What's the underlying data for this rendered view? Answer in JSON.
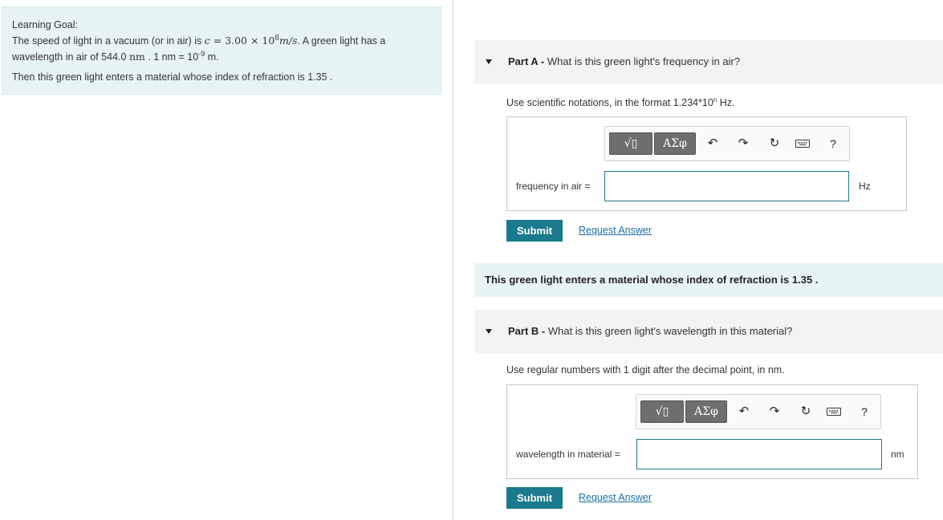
{
  "learning_goal": {
    "title": "Learning Goal:",
    "line1_pre": "The speed of light in a vacuum (or in air) is ",
    "c_symbol": "c",
    "equals": " = ",
    "speed_coef": "3.00 × 10",
    "speed_exp": "8",
    "speed_unit": "m/s",
    "line1_post": ". A green light has a",
    "line2_pre": "wavelength in air of 544.0 ",
    "line2_unit": "nm",
    "line2_mid": " . 1 nm = 10",
    "line2_exp": "-9",
    "line2_post": " m.",
    "line3": "Then this green light enters a material whose index of refraction is 1.35 ."
  },
  "part_a": {
    "label": "Part A -",
    "question": " What is this green light's frequency in air?",
    "instruction_pre": "Use scientific notations, in the format 1.234*10",
    "instruction_exp": "n",
    "instruction_post": " Hz.",
    "toolbar": {
      "templates_label": "√▯",
      "symbols_label": "ΑΣφ",
      "undo_icon": "↶",
      "redo_icon": "↷",
      "reset_icon": "↻",
      "help_label": "?"
    },
    "field_label": "frequency in air =",
    "field_value": "",
    "unit": "Hz",
    "submit_label": "Submit",
    "request_label": "Request Answer"
  },
  "banner_text": "This green light enters a material whose index of refraction is 1.35 .",
  "part_b": {
    "label": "Part B -",
    "question": " What is this green light's wavelength in this material?",
    "instruction": "Use  regular numbers with 1 digit after the decimal point, in nm.",
    "toolbar": {
      "templates_label": "√▯",
      "symbols_label": "ΑΣφ",
      "undo_icon": "↶",
      "redo_icon": "↷",
      "reset_icon": "↻",
      "help_label": "?"
    },
    "field_label": "wavelength in material =",
    "field_value": "",
    "unit": "nm",
    "submit_label": "Submit",
    "request_label": "Request Answer"
  },
  "colors": {
    "accent": "#1c7a8e",
    "goal_bg": "#e7f4f6",
    "part_bg": "#f3f3f3",
    "link": "#1b6ea5"
  }
}
